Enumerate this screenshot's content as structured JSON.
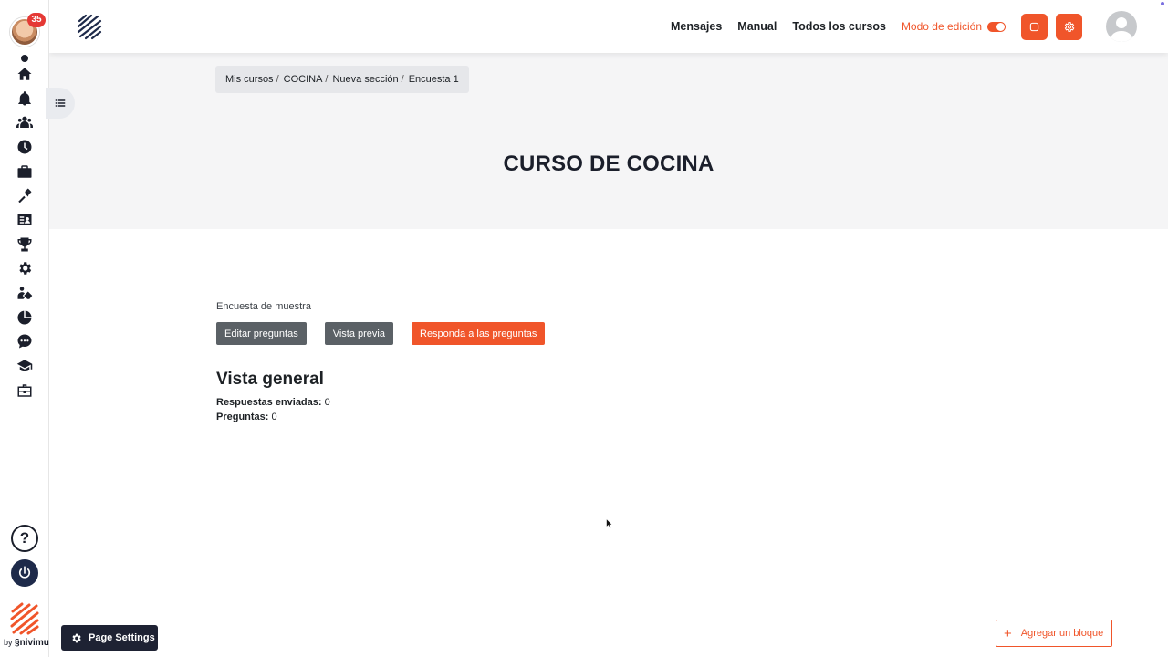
{
  "rail": {
    "notification_count": "35",
    "icons": [
      "home-icon",
      "bell-icon",
      "users-icon",
      "clock-icon",
      "briefcase-icon",
      "tools-icon",
      "id-card-icon",
      "trophy-icon",
      "gear-icon",
      "handshake-icon",
      "pie-chart-icon",
      "chat-icon",
      "graduation-cap-icon",
      "toolbox-icon"
    ],
    "help_label": "?",
    "by_label": "by",
    "brand_label": "nivimu"
  },
  "navbar": {
    "links": [
      "Mensajes",
      "Manual",
      "Todos los cursos"
    ],
    "edit_mode_label": "Modo de edición",
    "edit_mode_on": true
  },
  "breadcrumb": [
    "Mis cursos",
    "COCINA",
    "Nueva sección",
    "Encuesta 1"
  ],
  "page_title": "CURSO DE COCINA",
  "survey": {
    "intro": "Encuesta de muestra",
    "buttons": {
      "edit": "Editar preguntas",
      "preview": "Vista previa",
      "respond": "Responda a las preguntas"
    }
  },
  "overview": {
    "title": "Vista general",
    "responses_label": "Respuestas enviadas:",
    "responses_value": "0",
    "questions_label": "Preguntas:",
    "questions_value": "0"
  },
  "footer": {
    "page_settings": "Page Settings",
    "add_block": "Agregar un bloque"
  },
  "colors": {
    "accent": "#f0552a",
    "dark": "#1e2233",
    "gray_button": "#5b6166"
  }
}
